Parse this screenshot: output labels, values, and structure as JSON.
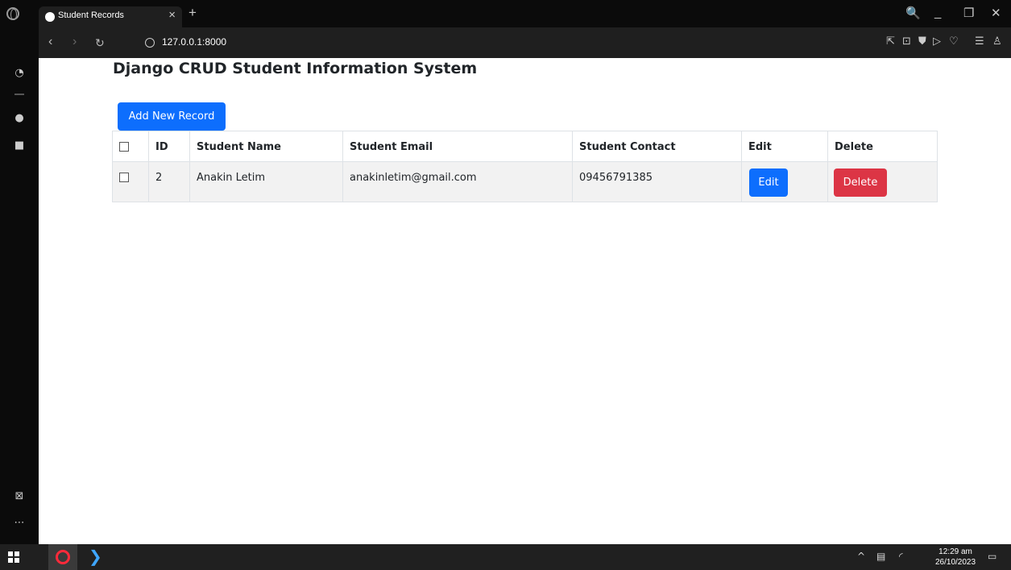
{
  "browser": {
    "tab_title": "Student Records",
    "tab_close": "×",
    "new_tab": "+",
    "url": "127.0.0.1:8000",
    "search": "🔍",
    "minimize": "_",
    "restore": "❐",
    "close": "✕"
  },
  "page": {
    "title": "Django CRUD Student Information System",
    "add_button": "Add New Record",
    "table": {
      "headers": {
        "id": "ID",
        "name": "Student Name",
        "email": "Student Email",
        "contact": "Student Contact",
        "edit": "Edit",
        "delete": "Delete"
      },
      "rows": [
        {
          "id": "2",
          "name": "Anakin Letim",
          "email": "anakinletim@gmail.com",
          "contact": "09456791385",
          "edit_label": "Edit",
          "delete_label": "Delete"
        }
      ]
    }
  },
  "taskbar": {
    "time": "12:29 am",
    "date": "26/10/2023"
  },
  "colors": {
    "primary": "#0d6efd",
    "danger": "#dc3545"
  }
}
